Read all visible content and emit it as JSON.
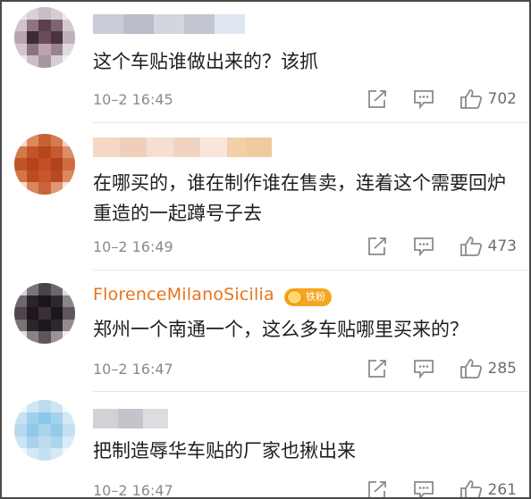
{
  "comments": [
    {
      "author": "",
      "author_blurred": true,
      "text": "这个车贴谁做出来的？该抓",
      "time": "10–2 16:45",
      "likes": "702"
    },
    {
      "author": "",
      "author_blurred": true,
      "text": "在哪买的，谁在制作谁在售卖，连着这个需要回炉重造的一起蹲号子去",
      "time": "10–2 16:49",
      "likes": "473"
    },
    {
      "author": "FlorenceMilanoSicilia",
      "author_blurred": false,
      "badge": "铁粉",
      "text": "郑州一个南通一个，这么多车贴哪里买来的？",
      "time": "10–2 16:47",
      "likes": "285"
    },
    {
      "author": "",
      "author_blurred": true,
      "text": "把制造辱华车贴的厂家也揪出来",
      "time": "10–2 16:47",
      "likes": "261"
    }
  ],
  "icons": {
    "share": "share-icon",
    "reply": "comment-icon",
    "like": "thumbs-up-icon"
  },
  "colors": {
    "username_accent": "#e8731e",
    "badge": "#f5a623",
    "meta_gray": "#8a8a8a"
  }
}
